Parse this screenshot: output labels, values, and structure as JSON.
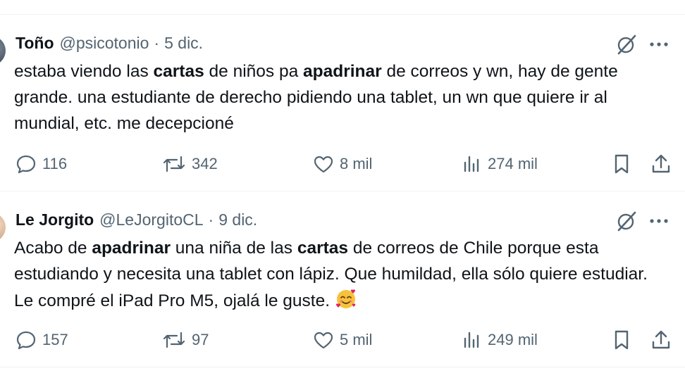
{
  "tweets": [
    {
      "name": "Toño",
      "handle": "@psicotonio",
      "separator": "·",
      "date": "5 dic.",
      "text": [
        {
          "t": "estaba viendo las ",
          "b": false
        },
        {
          "t": "cartas",
          "b": true
        },
        {
          "t": " de niños pa ",
          "b": false
        },
        {
          "t": "apadrinar",
          "b": true
        },
        {
          "t": " de correos y wn, hay de gente grande. una estudiante de derecho pidiendo una tablet, un wn que quiere ir al mundial, etc. me decepcioné",
          "b": false
        }
      ],
      "replies": "116",
      "reposts": "342",
      "likes": "8 mil",
      "views": "274 mil"
    },
    {
      "name": "Le Jorgito",
      "handle": "@LeJorgitoCL",
      "separator": "·",
      "date": "9 dic.",
      "text": [
        {
          "t": "Acabo de ",
          "b": false
        },
        {
          "t": "apadrinar",
          "b": true
        },
        {
          "t": " una niña de las ",
          "b": false
        },
        {
          "t": "cartas",
          "b": true
        },
        {
          "t": " de correos de Chile porque esta estudiando y necesita una tablet con lápiz. Que humildad, ella sólo quiere estudiar. Le compré el iPad Pro M5, ojalá le guste. ",
          "b": false
        }
      ],
      "emoji": "smiling-face-with-hearts",
      "replies": "157",
      "reposts": "97",
      "likes": "5 mil",
      "views": "249 mil"
    }
  ],
  "icons": {
    "reply": "speech-bubble-icon",
    "repost": "repost-arrows-icon",
    "like": "heart-icon",
    "views": "bar-chart-icon",
    "bookmark": "bookmark-icon",
    "share": "share-icon",
    "grok": "grok-icon",
    "more": "more-dots-icon"
  },
  "colors": {
    "text": "#0f1419",
    "muted": "#536471",
    "divider": "#eff3f4"
  }
}
